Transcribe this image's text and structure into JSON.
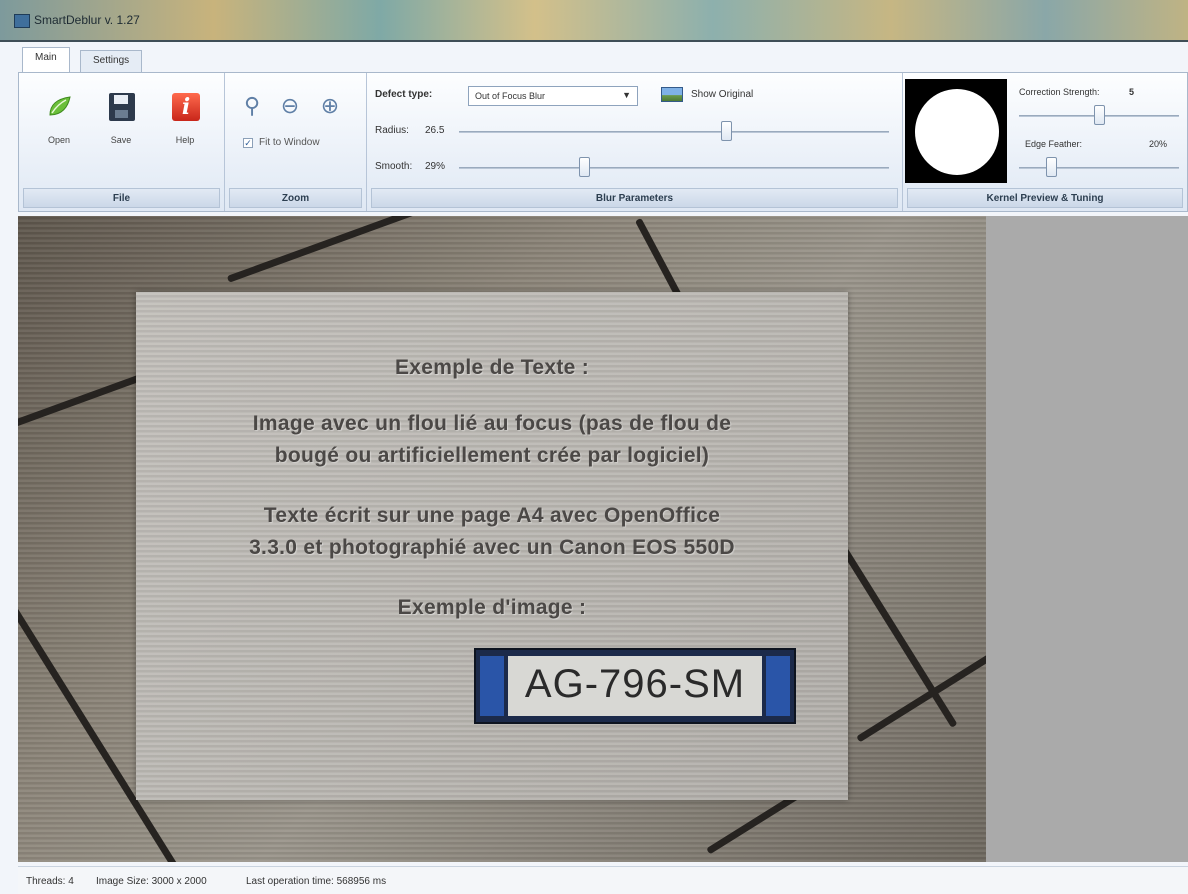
{
  "window": {
    "title": "SmartDeblur v. 1.27"
  },
  "tabs": [
    {
      "label": "Main",
      "active": true
    },
    {
      "label": "Settings",
      "active": false
    }
  ],
  "file_group": {
    "caption": "File",
    "buttons": [
      {
        "label": "Open",
        "icon": "open-icon"
      },
      {
        "label": "Save",
        "icon": "save-icon"
      },
      {
        "label": "Help",
        "icon": "help-icon"
      }
    ]
  },
  "zoom_group": {
    "caption": "Zoom",
    "icons": [
      "zoom-icon",
      "zoom-out-icon",
      "zoom-in-icon"
    ],
    "fit_to_window": {
      "label": "Fit to Window",
      "checked": true
    }
  },
  "blur_group": {
    "caption": "Blur Parameters",
    "defect_type_label": "Defect type:",
    "defect_type_value": "Out of Focus Blur",
    "show_original_label": "Show Original",
    "radius_label": "Radius:",
    "radius_value": "26.5",
    "smooth_label": "Smooth:",
    "smooth_value": "29%",
    "radius_level": 0.62,
    "smooth_level": 0.29
  },
  "kernel_group": {
    "caption": "Kernel Preview & Tuning",
    "correction_strength_label": "Correction Strength:",
    "correction_strength_value": "5",
    "edge_feather_label": "Edge Feather:",
    "edge_feather_value": "20%",
    "correction_level": 0.5,
    "feather_level": 0.2
  },
  "image": {
    "heading1": "Exemple de Texte :",
    "line1": "Image avec un flou lié au focus (pas de flou de",
    "line2": "bougé ou artificiellement crée par logiciel)",
    "line3": "Texte écrit sur une page A4 avec OpenOffice",
    "line4": "3.3.0 et photographié avec un Canon EOS 550D",
    "heading2": "Exemple d'image :",
    "plate_text": "AG-796-SM"
  },
  "status": {
    "threads": "Threads: 4",
    "image_size": "Image Size: 3000 x 2000",
    "last_op": "Last operation time: 568956 ms"
  },
  "colors": {
    "ribbon_top": "#fdfeff",
    "ribbon_bottom": "#dfe8f4",
    "canvas_bg": "#aaaaaa",
    "help_red": "#c8261a"
  }
}
